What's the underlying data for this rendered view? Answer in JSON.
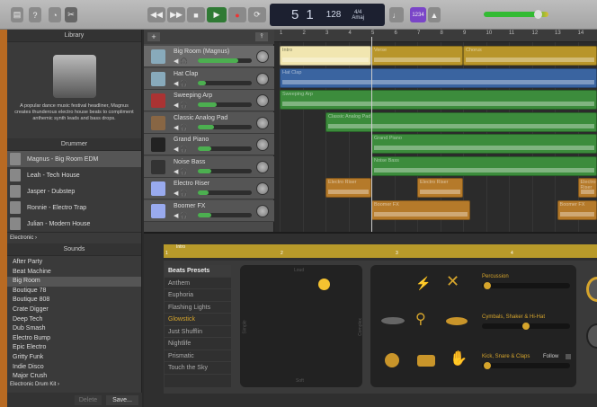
{
  "toolbar": {
    "buttons": [
      "library-icon",
      "help-icon",
      "smart-controls-icon",
      "editors-icon"
    ],
    "transport": [
      "rewind",
      "fast-forward",
      "stop",
      "play",
      "record",
      "cycle"
    ],
    "lcd": {
      "bar": "5",
      "beat": "1",
      "tempo": "128",
      "time_signature": "4/4",
      "key": "Amaj"
    },
    "count_in": "1234",
    "master_volume": 0.85
  },
  "library": {
    "title": "Library",
    "description": "A popular dance music festival headliner, Magnus creates thunderous electro house beats to compliment anthemic synth leads and bass drops.",
    "drummer_header": "Drummer",
    "drummers": [
      "Magnus - Big Room EDM",
      "Leah - Tech House",
      "Jasper - Dubstep",
      "Ronnie - Electro Trap",
      "Julian - Modern House"
    ],
    "genre": "Electronic",
    "sounds_header": "Sounds",
    "sounds": [
      "After Party",
      "Beat Machine",
      "Big Room",
      "Boutique 78",
      "Boutique 808",
      "Crate Digger",
      "Deep Tech",
      "Dub Smash",
      "Electro Bump",
      "Epic Electro",
      "Gritty Funk",
      "Indie Disco",
      "Major Crush"
    ],
    "selected_sound": "Big Room",
    "kit": "Electronic Drum Kit",
    "delete": "Delete",
    "save": "Save..."
  },
  "tracks": [
    {
      "name": "Big Room (Magnus)",
      "volume": 0.75,
      "color": "#8ab"
    },
    {
      "name": "Hat Clap",
      "volume": 0.15,
      "color": "#8ab"
    },
    {
      "name": "Sweeping Arp",
      "volume": 0.35,
      "color": "#a33"
    },
    {
      "name": "Classic Analog Pad",
      "volume": 0.3,
      "color": "#864"
    },
    {
      "name": "Grand Piano",
      "volume": 0.25,
      "color": "#222"
    },
    {
      "name": "Noise Bass",
      "volume": 0.25,
      "color": "#333"
    },
    {
      "name": "Electro Riser",
      "volume": 0.2,
      "color": "#9ae"
    },
    {
      "name": "Boomer FX",
      "volume": 0.25,
      "color": "#9ae"
    }
  ],
  "ruler": [
    "1",
    "2",
    "3",
    "4",
    "5",
    "6",
    "7",
    "8",
    "9",
    "10",
    "11",
    "12",
    "13",
    "14"
  ],
  "playhead_bar": 5,
  "regions": [
    {
      "track": 0,
      "label": "Intro",
      "start": 1,
      "end": 5,
      "color": "#f1e6b0"
    },
    {
      "track": 0,
      "label": "Verse",
      "start": 5,
      "end": 9,
      "color": "#b8952a"
    },
    {
      "track": 0,
      "label": "Chorus",
      "start": 9,
      "end": 15,
      "color": "#b8952a"
    },
    {
      "track": 1,
      "label": "Hat Clap",
      "start": 1,
      "end": 15,
      "color": "#3a64a0"
    },
    {
      "track": 2,
      "label": "Sweeping Arp",
      "start": 1,
      "end": 15,
      "color": "#3c8c3c"
    },
    {
      "track": 3,
      "label": "Classic Analog Pad",
      "start": 3,
      "end": 15,
      "color": "#3c8c3c"
    },
    {
      "track": 4,
      "label": "Grand Piano",
      "start": 5,
      "end": 15,
      "color": "#3c8c3c"
    },
    {
      "track": 5,
      "label": "Noise Bass",
      "start": 5,
      "end": 15,
      "color": "#3c8c3c"
    },
    {
      "track": 6,
      "label": "Electro Riser",
      "start": 3,
      "end": 5,
      "color": "#b57a2a"
    },
    {
      "track": 6,
      "label": "Electro Riser",
      "start": 7,
      "end": 9,
      "color": "#b57a2a"
    },
    {
      "track": 6,
      "label": "Electro Riser",
      "start": 14,
      "end": 15,
      "color": "#b57a2a"
    },
    {
      "track": 7,
      "label": "Boomer FX",
      "start": 5,
      "end": 9.3,
      "color": "#b57a2a"
    },
    {
      "track": 7,
      "label": "Boomer FX",
      "start": 13.1,
      "end": 15,
      "color": "#b57a2a"
    }
  ],
  "editor": {
    "region": "Intro",
    "ruler": [
      "1",
      "2",
      "3",
      "4"
    ],
    "presets_header": "Beats Presets",
    "presets": [
      "Anthem",
      "Euphoria",
      "Flashing Lights",
      "Glowstick",
      "Just Shufflin",
      "Nightlife",
      "Prismatic",
      "Touch the Sky"
    ],
    "selected_preset": "Glowstick",
    "xy": {
      "top": "Loud",
      "bottom": "Soft",
      "left": "Simple",
      "right": "Complex"
    },
    "percussion": "Percussion",
    "percussion_value": 0.02,
    "cymbals": "Cymbals, Shaker & Hi-Hat",
    "cymbals_value": 0.5,
    "kick": "Kick, Snare & Claps",
    "kick_value": 0.02,
    "follow": "Follow"
  }
}
